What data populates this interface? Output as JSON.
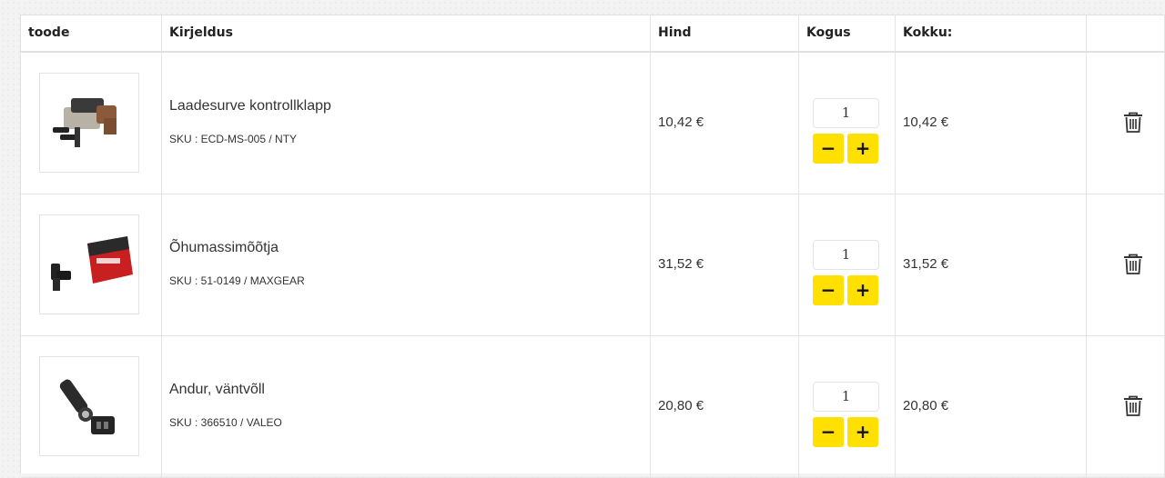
{
  "header": {
    "col_product": "toode",
    "col_description": "Kirjeldus",
    "col_price": "Hind",
    "col_quantity": "Kogus",
    "col_total": "Kokku:"
  },
  "quantity_controls": {
    "minus": "−",
    "plus": "+"
  },
  "items": [
    {
      "name": "Laadesurve kontrollklapp",
      "sku": "SKU : ECD-MS-005 / NTY",
      "price": "10,42 €",
      "quantity": "1",
      "total": "10,42 €"
    },
    {
      "name": "Õhumassimõõtja",
      "sku": "SKU : 51-0149 / MAXGEAR",
      "price": "31,52 €",
      "quantity": "1",
      "total": "31,52 €"
    },
    {
      "name": "Andur, väntvõll",
      "sku": "SKU : 366510 / VALEO",
      "price": "20,80 €",
      "quantity": "1",
      "total": "20,80 €"
    }
  ],
  "colors": {
    "accent": "#ffe000",
    "border": "#e4e4e4"
  },
  "icons": [
    "trash-icon",
    "minus-icon",
    "plus-icon"
  ]
}
